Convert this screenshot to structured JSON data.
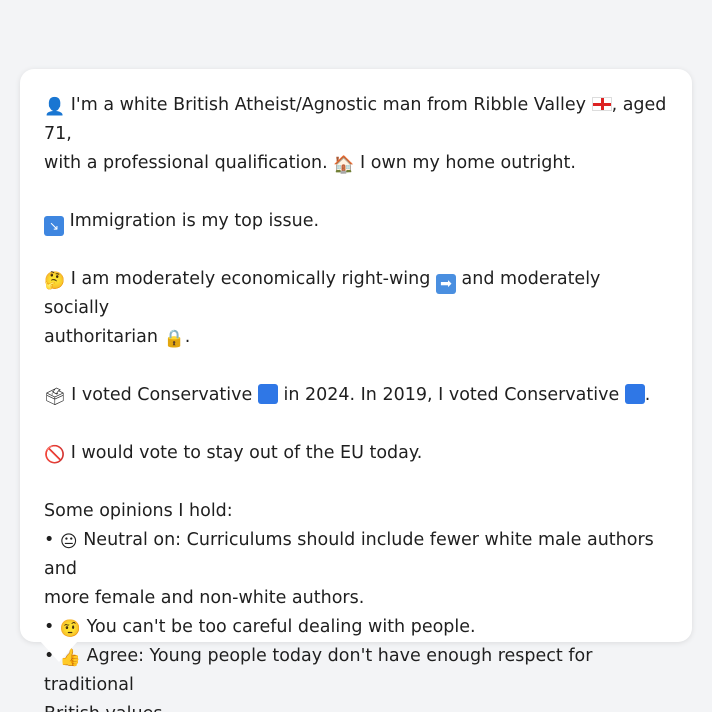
{
  "profile": {
    "intro_pre": "I'm a white British Atheist/Agnostic man from Ribble Valley",
    "intro_post": ", aged 71,",
    "intro_line2_pre": "with a professional qualification.",
    "intro_line2_post": "I own my home outright.",
    "top_issue": "Immigration is my top issue.",
    "econ_pre": "I am moderately economically right-wing",
    "econ_post": "and moderately socially",
    "social_line2": "authoritarian",
    "social_line2_post": ".",
    "vote_pre": "I voted Conservative",
    "vote_mid": "in 2024. In 2019, I voted Conservative",
    "vote_post": ".",
    "eu": "I would vote to stay out of the EU today.",
    "opinions_heading": "Some opinions I hold:",
    "opinions": [
      {
        "bullet": "•",
        "line1": "Neutral on: Curriculums should include fewer white male authors and",
        "line2": "more female and non-white authors."
      },
      {
        "bullet": "•",
        "line1": "You can't be too careful dealing with people.",
        "line2": ""
      },
      {
        "bullet": "•",
        "line1": "Agree: Young people today don't have enough respect for traditional",
        "line2": "British values."
      }
    ]
  },
  "icons": {
    "person": "person-silhouette-icon",
    "flag": "england-flag-icon",
    "house": "house-icon",
    "issue": "immigration-icon",
    "thinking": "thinking-face-icon",
    "arrow": "right-arrow-icon",
    "lock": "lock-icon",
    "ballot": "ballot-box-icon",
    "party": "conservative-blue-square-icon",
    "no": "prohibited-icon",
    "neutral": "neutral-face-icon",
    "skeptical": "raised-eyebrow-face-icon",
    "thumbs": "thumbs-up-icon"
  },
  "colors": {
    "background": "#f3f4f6",
    "bubble": "#ffffff",
    "text": "#1f1f1f",
    "conservative": "#2f77e6"
  }
}
